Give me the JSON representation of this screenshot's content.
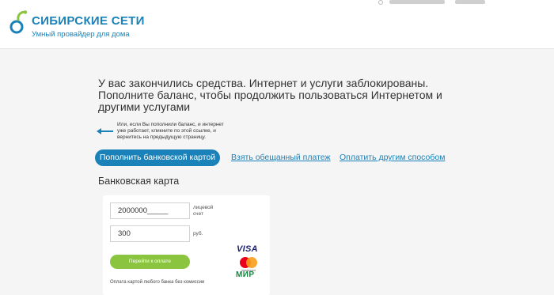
{
  "header": {
    "brand_name": "СИБИРСКИЕ СЕТИ",
    "brand_tagline": "Умный провайдер для дома"
  },
  "notice": {
    "line1": "У вас закончились средства. Интернет и услуги заблокированы.",
    "line2": "Пополните баланс, чтобы продолжить пользоваться Интернетом и",
    "line3": "другими услугами"
  },
  "hint": {
    "line1": "Или, если Вы пополнили баланс, и интернет",
    "line2": "уже работает, кликните по этой ссылке, и",
    "line3": "вернитесь на предыдущую страницу."
  },
  "tabs": {
    "active": "Пополнить банковской картой",
    "promise": "Взять обещанный платеж",
    "other": "Оплатить другим способом"
  },
  "payment": {
    "title": "Банковская карта",
    "account_value": "2000000_____",
    "account_label_1": "лицевой",
    "account_label_2": "счет",
    "amount_value": "300",
    "amount_unit": "руб.",
    "button": "Перейти к оплате",
    "note": "Оплата картой любого банка без комиссии",
    "visa": "VISA",
    "mastercard_text": "mastercard",
    "mir": "МИР"
  },
  "colors": {
    "brand_blue": "#1a82b8",
    "button_green": "#8bc53f"
  }
}
